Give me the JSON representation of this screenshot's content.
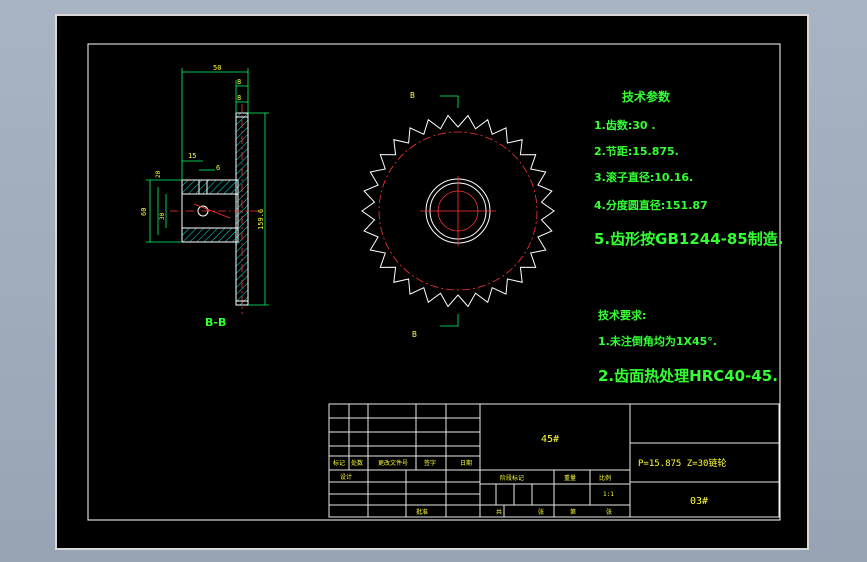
{
  "colors": {
    "sheet": "#000000",
    "outline": "#ffffff",
    "text_yellow": "#ffff33",
    "text_green": "#33ff33",
    "dims": "#00e5e5",
    "centerline": "#ff3333",
    "hatch": "#00e5e5"
  },
  "section_view": {
    "label": "B-B",
    "dims": {
      "d50": "50",
      "d8a": "8",
      "d8b": "8",
      "d15": "15",
      "d6": "6",
      "d60": "60",
      "d30": "30",
      "d20": "20",
      "d159": "159.6"
    }
  },
  "front_view": {
    "teeth": 30,
    "cut_a": "B",
    "cut_b": "B"
  },
  "tech_params": {
    "title": "技术参数",
    "lines": [
      "1.齿数:30 .",
      "2.节距:15.875.",
      "3.滚子直径:10.16.",
      "4.分度圆直径:151.87"
    ],
    "big_line": "5.齿形按GB1244-85制造."
  },
  "tech_req": {
    "title": "技术要求:",
    "line1": "1.未注倒角均为1X45°.",
    "line2": "2.齿面热处理HRC40-45."
  },
  "title_block": {
    "material": "45#",
    "part_name": "P=15.875 Z=30链轮",
    "drawing_no": "03#",
    "row_labels": [
      "标记",
      "处数",
      "更改文件号",
      "签字",
      "日期"
    ],
    "designer": "设计",
    "stage_label": "阶段标记",
    "weight_label": "重量",
    "scale_label": "比例",
    "scale_value": "1:1",
    "sheet_total": "共",
    "sheet_no": "第",
    "sheet_page": "张",
    "approve": "批准"
  }
}
